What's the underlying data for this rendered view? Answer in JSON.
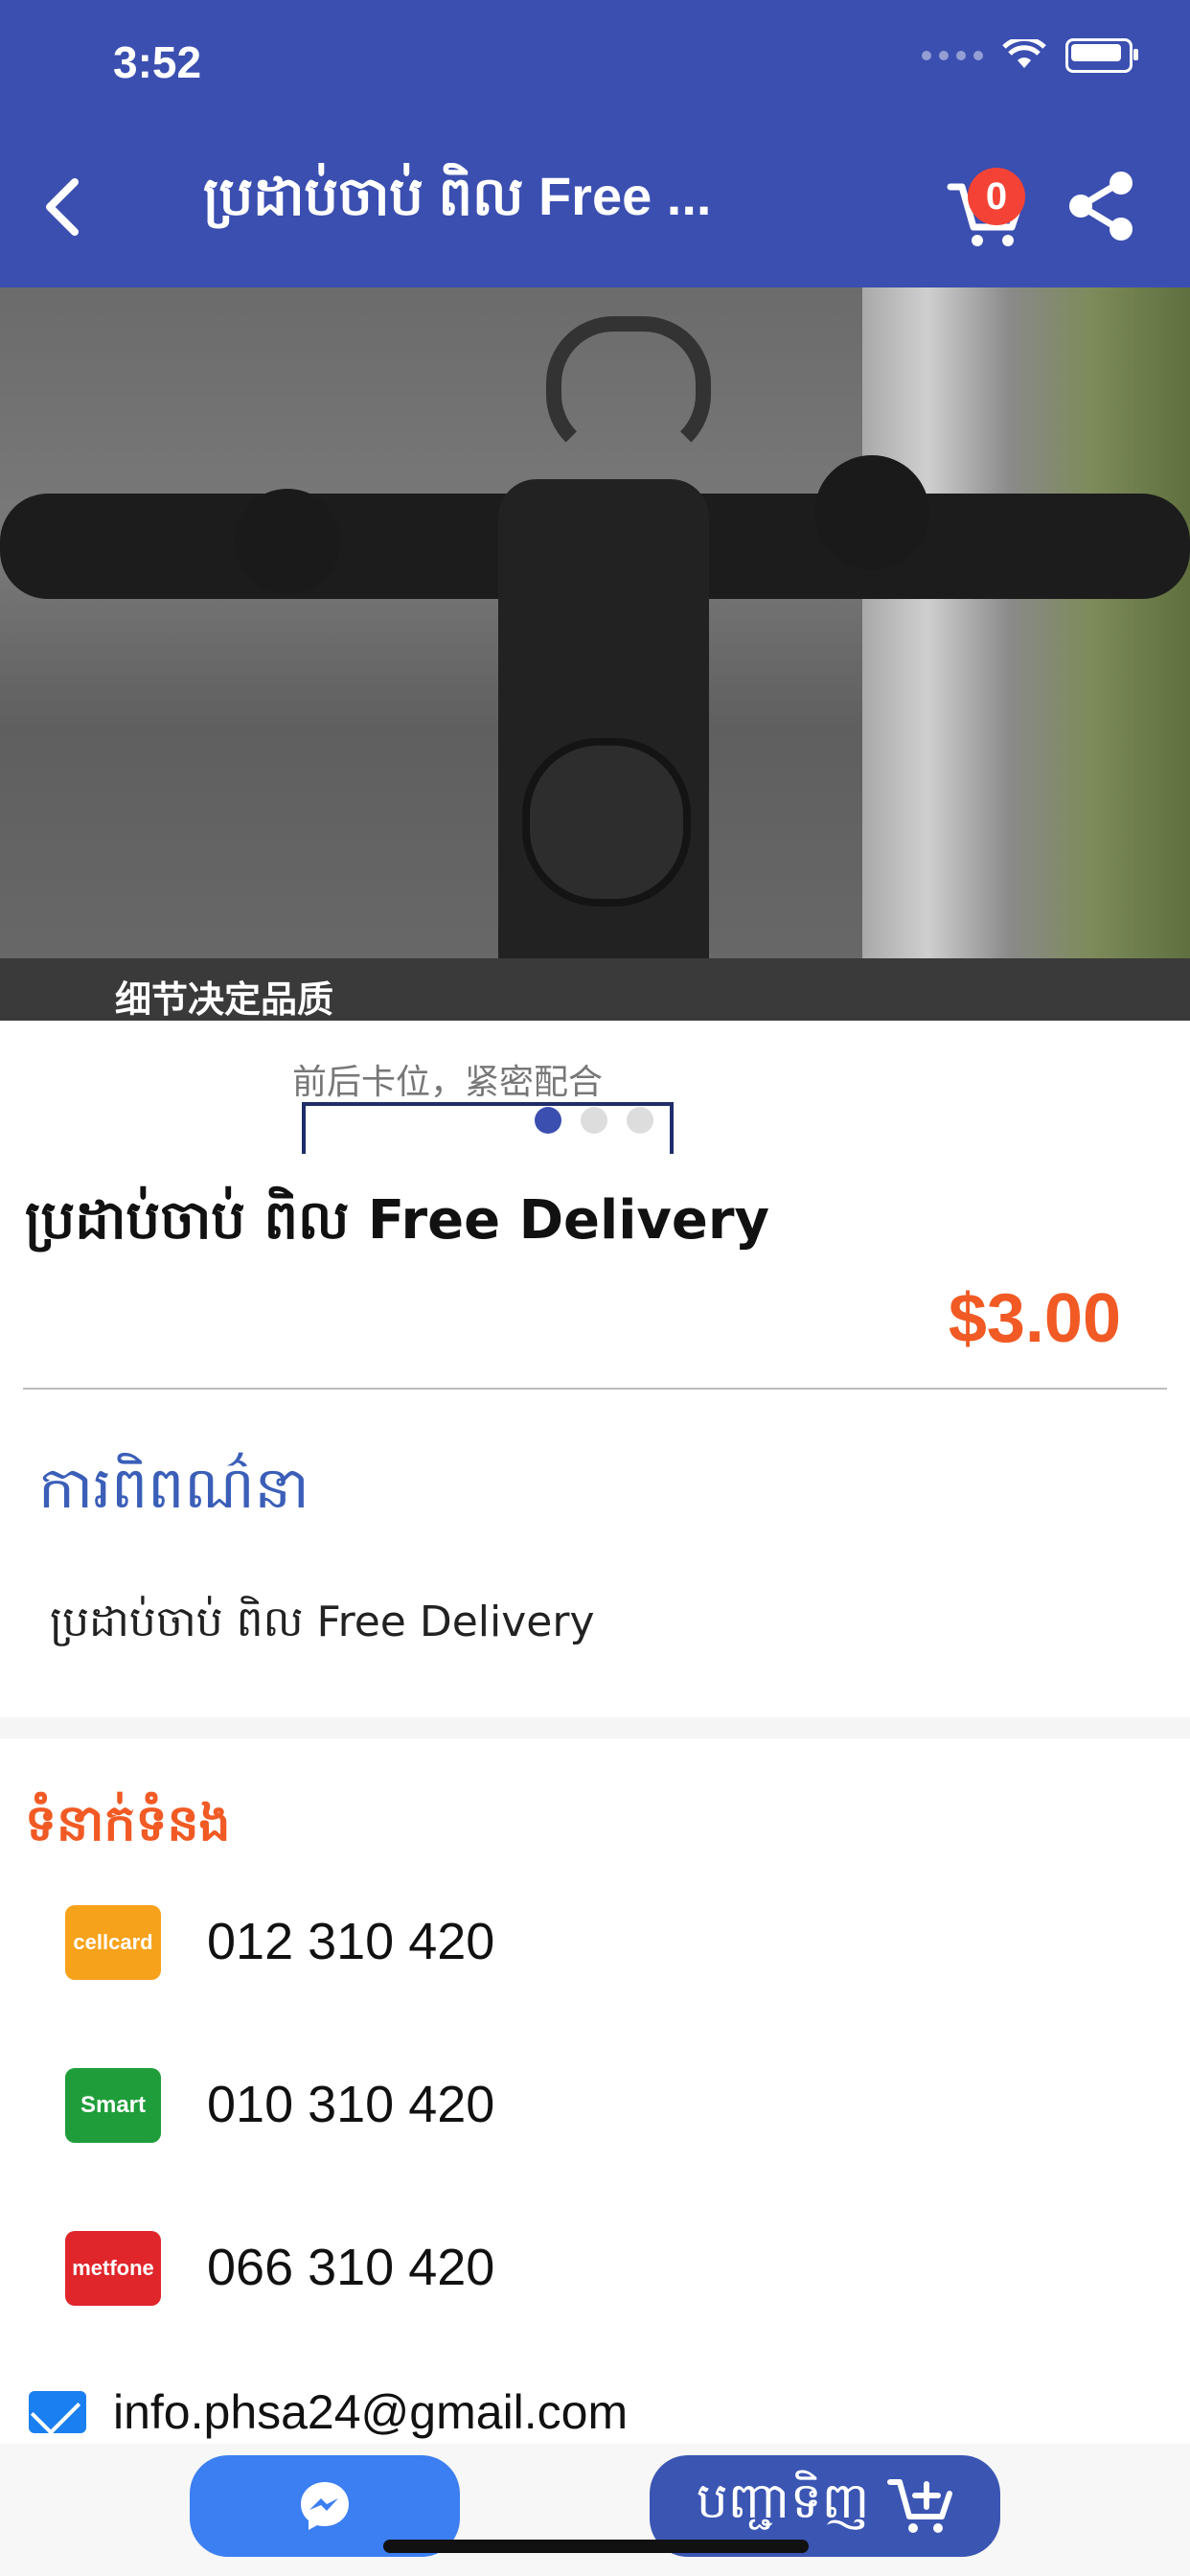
{
  "status_bar": {
    "time": "3:52"
  },
  "header": {
    "title": "ប្រដាប់ចាប់ ពិល Free ...",
    "cart_count": "0",
    "bg_color": "#3b4fb0"
  },
  "carousel": {
    "caption": "细节决定品质",
    "sub_caption": "前后卡位，紧密配合",
    "dot_count": 3,
    "active_dot": 0
  },
  "product": {
    "title": "ប្រដាប់ចាប់ ពិល Free Delivery",
    "price": "$3.00"
  },
  "description": {
    "heading": "ការពិពណ៌នា",
    "text": "ប្រដាប់ចាប់ ពិល Free Delivery"
  },
  "contact": {
    "heading": "ទំនាក់ទំនង",
    "phones": [
      {
        "carrier": "cellcard",
        "number": "012 310 420"
      },
      {
        "carrier": "Smart",
        "number": "010 310 420"
      },
      {
        "carrier": "metfone",
        "number": "066 310 420"
      }
    ],
    "email": "info.phsa24@gmail.com"
  },
  "bottom_bar": {
    "buy_label": "បញ្ជាទិញ"
  },
  "icons": {
    "back": "chevron-left-icon",
    "cart": "cart-icon",
    "share": "share-icon",
    "messenger": "messenger-icon",
    "add_cart": "add-to-cart-icon",
    "mail": "mail-icon"
  }
}
